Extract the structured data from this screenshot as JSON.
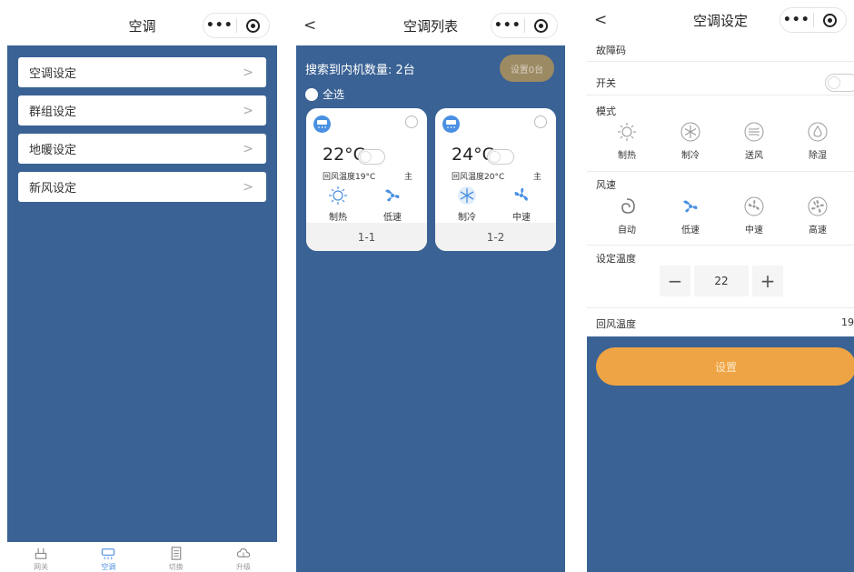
{
  "screen1": {
    "title": "空调",
    "menu": [
      {
        "label": "空调设定"
      },
      {
        "label": "群组设定"
      },
      {
        "label": "地暖设定"
      },
      {
        "label": "新风设定"
      }
    ],
    "tabs": [
      {
        "label": "网关",
        "icon": "gateway-icon",
        "active": false
      },
      {
        "label": "空调",
        "icon": "ac-icon",
        "active": true
      },
      {
        "label": "切换",
        "icon": "list-icon",
        "active": false
      },
      {
        "label": "升级",
        "icon": "cloud-icon",
        "active": false
      }
    ]
  },
  "screen2": {
    "title": "空调列表",
    "back": "<",
    "count_text": "搜索到内机数量: 2台",
    "set_button": "设置0台",
    "select_all": "全选",
    "cards": [
      {
        "temp": "22°C",
        "return_temp": "回风温度19°C",
        "role": "主",
        "mode": "制热",
        "mode_icon": "heat-icon",
        "speed": "低速",
        "speed_icon": "fan-low-icon",
        "id": "1-1"
      },
      {
        "temp": "24°C",
        "return_temp": "回风温度20°C",
        "role": "主",
        "mode": "制冷",
        "mode_icon": "cool-icon",
        "speed": "中速",
        "speed_icon": "fan-mid-icon",
        "id": "1-2"
      }
    ]
  },
  "screen3": {
    "title": "空调设定",
    "back": "<",
    "fault_label": "故障码",
    "switch_label": "开关",
    "mode_label": "模式",
    "modes": [
      {
        "label": "制热",
        "icon": "heat-icon",
        "selected": false
      },
      {
        "label": "制冷",
        "icon": "cool-icon",
        "selected": false
      },
      {
        "label": "送风",
        "icon": "fan-wind-icon",
        "selected": false
      },
      {
        "label": "除湿",
        "icon": "dehumidify-icon",
        "selected": false
      }
    ],
    "speed_label": "风速",
    "speeds": [
      {
        "label": "自动",
        "icon": "auto-icon",
        "selected": false
      },
      {
        "label": "低速",
        "icon": "fan-low-icon",
        "selected": true
      },
      {
        "label": "中速",
        "icon": "fan-mid-icon",
        "selected": false
      },
      {
        "label": "高速",
        "icon": "fan-high-icon",
        "selected": false
      }
    ],
    "set_temp_label": "设定温度",
    "minus": "−",
    "plus": "+",
    "set_temp_value": "22",
    "return_temp_label": "回风温度",
    "return_temp_value": "19",
    "submit_button": "设置"
  },
  "colors": {
    "background": "#3a6294",
    "accent": "#4a90e2",
    "submit": "#eea444",
    "set_button": "#9c8a63"
  }
}
